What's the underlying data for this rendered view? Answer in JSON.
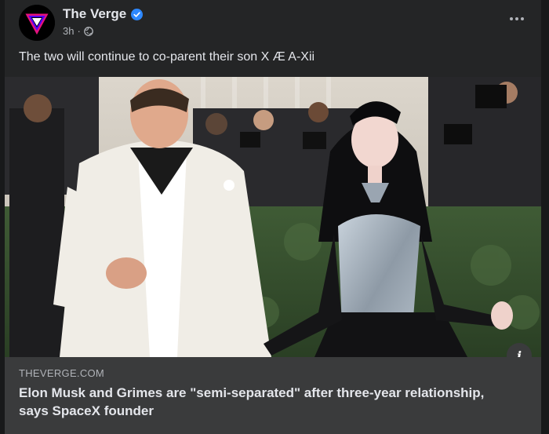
{
  "post": {
    "page_name": "The Verge",
    "time": "3h",
    "separator": "·",
    "caption": "The two will continue to co-parent their son X Æ A-Xii",
    "icons": {
      "avatar": "the-verge-logo",
      "verified": "verified-badge-icon",
      "audience": "globe-icon",
      "more": "more-options-icon",
      "info": "info-icon"
    },
    "colors": {
      "background": "#242526",
      "text": "#e4e6eb",
      "secondary_text": "#b0b3b8",
      "verified_blue": "#2d88ff",
      "preview_bg": "#3a3b3c"
    }
  },
  "link_preview": {
    "domain": "THEVERGE.COM",
    "headline": "Elon Musk and Grimes are \"semi-separated\" after three-year relationship, says SpaceX founder",
    "info_symbol": "i"
  }
}
